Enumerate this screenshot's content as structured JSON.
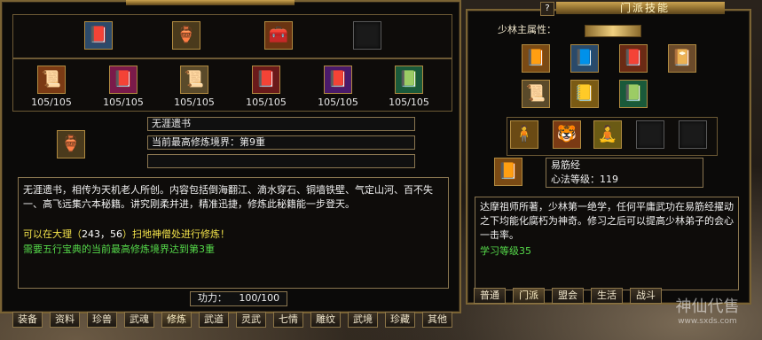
{
  "left": {
    "top_icons": [
      "📕",
      "🏺",
      "🧰",
      ""
    ],
    "book_icons": [
      "📜",
      "📕",
      "📜",
      "📕",
      "📕",
      "📗"
    ],
    "book_counts": [
      "105/105",
      "105/105",
      "105/105",
      "105/105",
      "105/105",
      "105/105"
    ],
    "selected_icon": "🏺",
    "book_name": "无涯遗书",
    "realm_text": "当前最高修炼境界：第9重",
    "desc": "无涯遗书，相传为天机老人所创。内容包括倒海翻江、滴水穿石、铜墙铁壁、气定山河、百不失一、高飞远集六本秘籍。讲究刚柔并进，精准迅捷，修炼此秘籍能一步登天。",
    "hint_prefix": "可以在大理（",
    "hint_coords": "243，56",
    "hint_suffix": "）扫地神僧处进行修炼！",
    "requirement": "需要五行宝典的当前最高修炼境界达到第3重",
    "power_label": "功力：",
    "power_value": "100/100",
    "tabs": [
      "装备",
      "资料",
      "珍兽",
      "武魂",
      "修炼",
      "武道",
      "灵武",
      "七情",
      "雕纹",
      "武境",
      "珍藏",
      "其他"
    ],
    "active_tab": 4
  },
  "right": {
    "title": "门派技能",
    "help_icon": "?",
    "attr_label": "少林主属性：",
    "skill_icons_row1": [
      "📙",
      "📘",
      "📕",
      "📔"
    ],
    "skill_icons_row2": [
      "📜",
      "📒",
      "📗"
    ],
    "skill_icons_row3": [
      "🧍",
      "🐯",
      "🧘",
      "",
      ""
    ],
    "cur_icon": "📙",
    "skill_name": "易筋经",
    "skill_level_text": "心法等级：119",
    "desc": "达摩祖师所著，少林第一绝学，任何平庸武功在易筋经擢动之下均能化腐朽为神奇。修习之后可以提高少林弟子的会心一击率。",
    "learn_text": "学习等级35",
    "tabs": [
      "普通",
      "门派",
      "盟会",
      "生活",
      "战斗"
    ],
    "active_tab": 1
  },
  "watermark": {
    "text": "神仙代售",
    "url": "www.sxds.com"
  },
  "colors": {
    "gold": "#c9a24f",
    "green": "#55d94a",
    "yellow": "#f2e24a",
    "text": "#f0f0f0"
  }
}
